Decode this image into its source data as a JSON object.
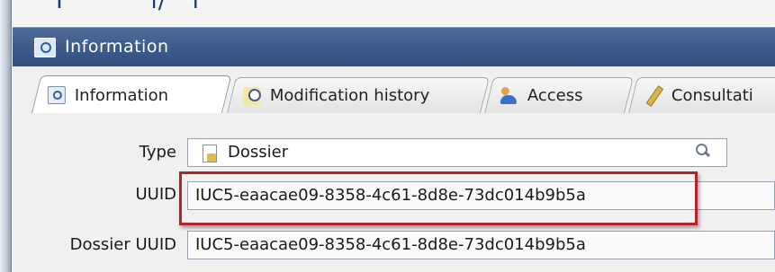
{
  "window": {
    "title": "Information"
  },
  "tabs": [
    {
      "label": "Information",
      "icon": "info-icon",
      "active": true
    },
    {
      "label": "Modification history",
      "icon": "clock-icon",
      "active": false
    },
    {
      "label": "Access",
      "icon": "users-icon",
      "active": false
    },
    {
      "label": "Consultati",
      "icon": "pen-icon",
      "active": false
    }
  ],
  "form": {
    "type": {
      "label": "Type",
      "value": "Dossier"
    },
    "uuid": {
      "label": "UUID",
      "value": "IUC5-eaacae09-8358-4c61-8d8e-73dc014b9b5a"
    },
    "dossier_uuid": {
      "label": "Dossier UUID",
      "value": "IUC5-eaacae09-8358-4c61-8d8e-73dc014b9b5a"
    }
  },
  "colors": {
    "titlebar": "#3e5b8a",
    "highlight": "#b0252b"
  }
}
